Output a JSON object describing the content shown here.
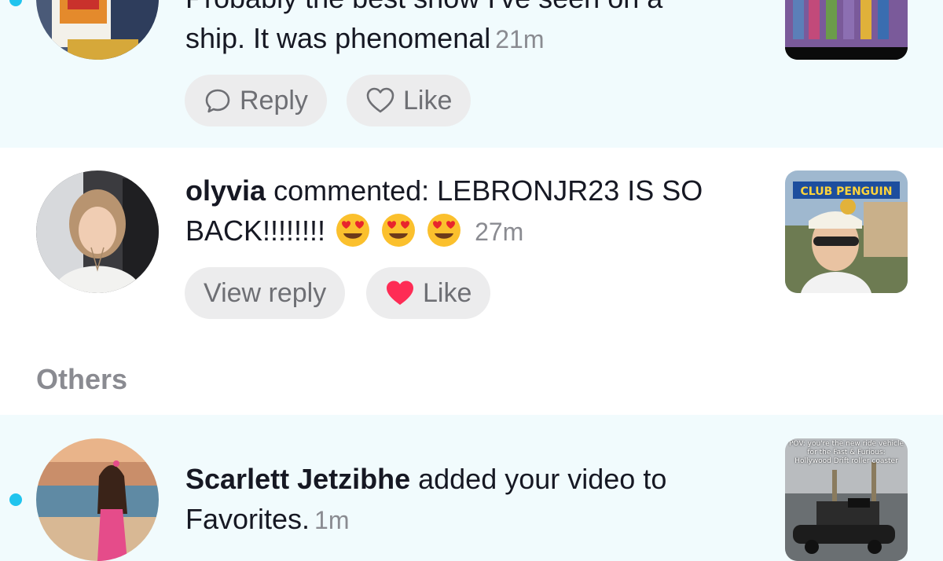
{
  "notifications": [
    {
      "text_partial_top": "Probably the best show I've seen on a",
      "text_line2": "ship. It was phenomenal",
      "time": "21m",
      "reply_label": "Reply",
      "like_label": "Like",
      "unread": true
    },
    {
      "username": "olyvia",
      "action": " commented: LEBRONJR23 IS SO BACK!!!!!!!!",
      "emojis": [
        "heart-eyes",
        "heart-eyes",
        "heart-eyes"
      ],
      "time": "27m",
      "view_reply_label": "View reply",
      "like_label": "Like",
      "liked": true,
      "thumb_text": "CLUB PENGUIN",
      "unread": false
    },
    {
      "username": "Scarlett Jetzibhe",
      "action": " added your video to Favorites.",
      "time": "1m",
      "thumb_text": "POV: you're the new ride vehicle for the Fast & Furious: Hollywood Drift roller coaster",
      "unread": true
    }
  ],
  "section_others": "Others",
  "colors": {
    "unread_bg": "#f1fbfd",
    "unread_dot": "#20c4ee",
    "like_red": "#fe2c55",
    "muted": "#8a8b91"
  }
}
